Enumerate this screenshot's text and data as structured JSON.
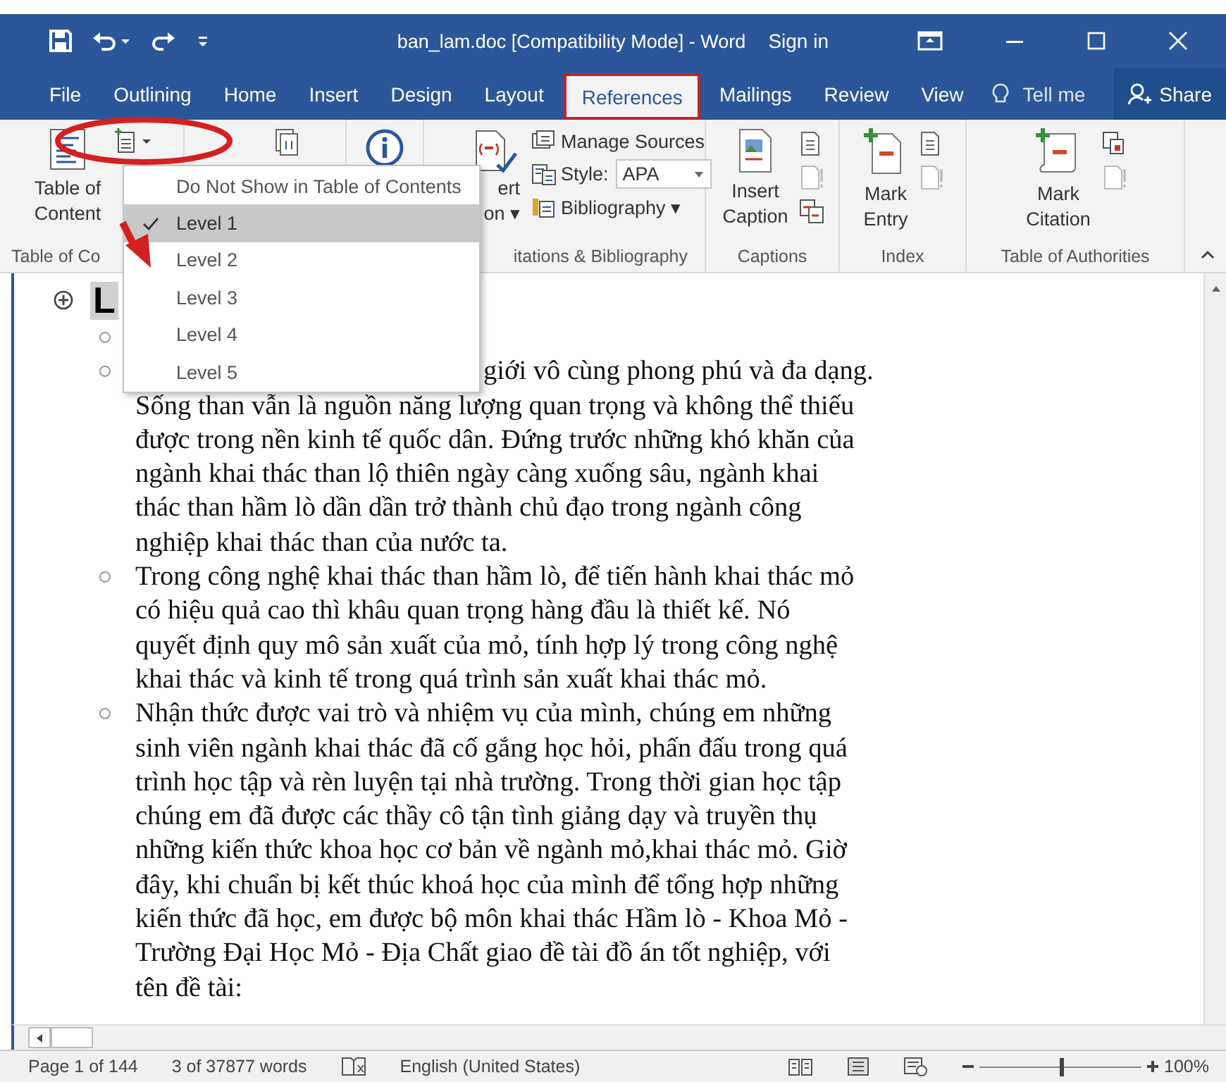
{
  "window": {
    "title": "ban_lam.doc [Compatibility Mode]  -  Word",
    "sign_in": "Sign in"
  },
  "tabs": [
    {
      "label": "File",
      "selected": false
    },
    {
      "label": "Outlining",
      "selected": false
    },
    {
      "label": "Home",
      "selected": false
    },
    {
      "label": "Insert",
      "selected": false
    },
    {
      "label": "Design",
      "selected": false
    },
    {
      "label": "Layout",
      "selected": false
    },
    {
      "label": "References",
      "selected": true
    },
    {
      "label": "Mailings",
      "selected": false
    },
    {
      "label": "Review",
      "selected": false
    },
    {
      "label": "View",
      "selected": false
    }
  ],
  "tell_me": "Tell me",
  "share": "Share",
  "ribbon": {
    "toc": {
      "lines": [
        "Table of",
        "Content"
      ],
      "group": "Table of Co"
    },
    "citations": {
      "insert_lines": [
        "ert",
        "on ▾"
      ],
      "manage_sources": "Manage Sources",
      "style_label": "Style:",
      "style_value": "APA",
      "bibliography": "Bibliography ▾",
      "group": "itations & Bibliography"
    },
    "captions": {
      "lines": [
        "Insert",
        "Caption"
      ],
      "group": "Captions"
    },
    "index": {
      "lines": [
        "Mark",
        "Entry"
      ],
      "group": "Index"
    },
    "authorities": {
      "lines": [
        "Mark",
        "Citation"
      ],
      "group": "Table of Authorities"
    }
  },
  "menu": [
    {
      "label": "Do Not Show in Table of Contents",
      "selected": false
    },
    {
      "label": "Level 1",
      "selected": true
    },
    {
      "label": "Level 2",
      "selected": false
    },
    {
      "label": "Level 3",
      "selected": false
    },
    {
      "label": "Level 4",
      "selected": false
    },
    {
      "label": "Level 5",
      "selected": false
    }
  ],
  "document": {
    "heading": "L",
    "paragraphs": [
      {
        "first_line": "giới vô cùng phong phú và đa dạng.",
        "lines": [
          "Sống than vẫn là nguồn năng lượng quan trọng và không thể thiếu",
          "được trong nền kinh tế quốc dân. Đứng trước những khó khăn của",
          "ngành khai thác than lộ thiên ngày càng xuống sâu, ngành khai",
          "thác than hầm lò dần dần trở thành chủ đạo trong ngành công",
          "nghiệp khai thác than của nước ta."
        ]
      },
      {
        "lines": [
          "Trong công nghệ khai thác than hầm lò, để tiến hành khai thác mỏ",
          "có hiệu quả cao thì khâu quan trọng hàng đầu là thiết kế.  Nó",
          "quyết định quy mô sản xuất của mỏ, tính hợp lý trong công nghệ",
          "khai thác và kinh tế trong quá trình sản xuất khai thác mỏ."
        ]
      },
      {
        "lines": [
          "Nhận thức được vai trò và nhiệm vụ của mình, chúng em những",
          "sinh viên ngành khai thác đã cố gắng học hỏi, phấn đấu trong quá",
          "trình học tập và rèn luyện tại nhà trường. Trong thời gian học tập",
          "chúng em đã được các thầy cô tận tình giảng dạy và truyền thụ",
          "những kiến thức khoa học cơ bản về ngành mỏ,khai thác mỏ. Giờ",
          "đây, khi chuẩn bị kết thúc khoá học của mình để tổng hợp những",
          "kiến thức đã học, em được bộ môn khai thác Hầm lò - Khoa Mỏ -",
          "Trường Đại Học Mỏ - Địa Chất giao đề tài đồ án tốt nghiệp, với",
          "tên đề tài:"
        ]
      }
    ]
  },
  "status": {
    "page": "Page 1 of 144",
    "words": "3 of 37877 words",
    "language": "English (United States)",
    "zoom": {
      "level": 0.5,
      "reading": "100%"
    }
  }
}
